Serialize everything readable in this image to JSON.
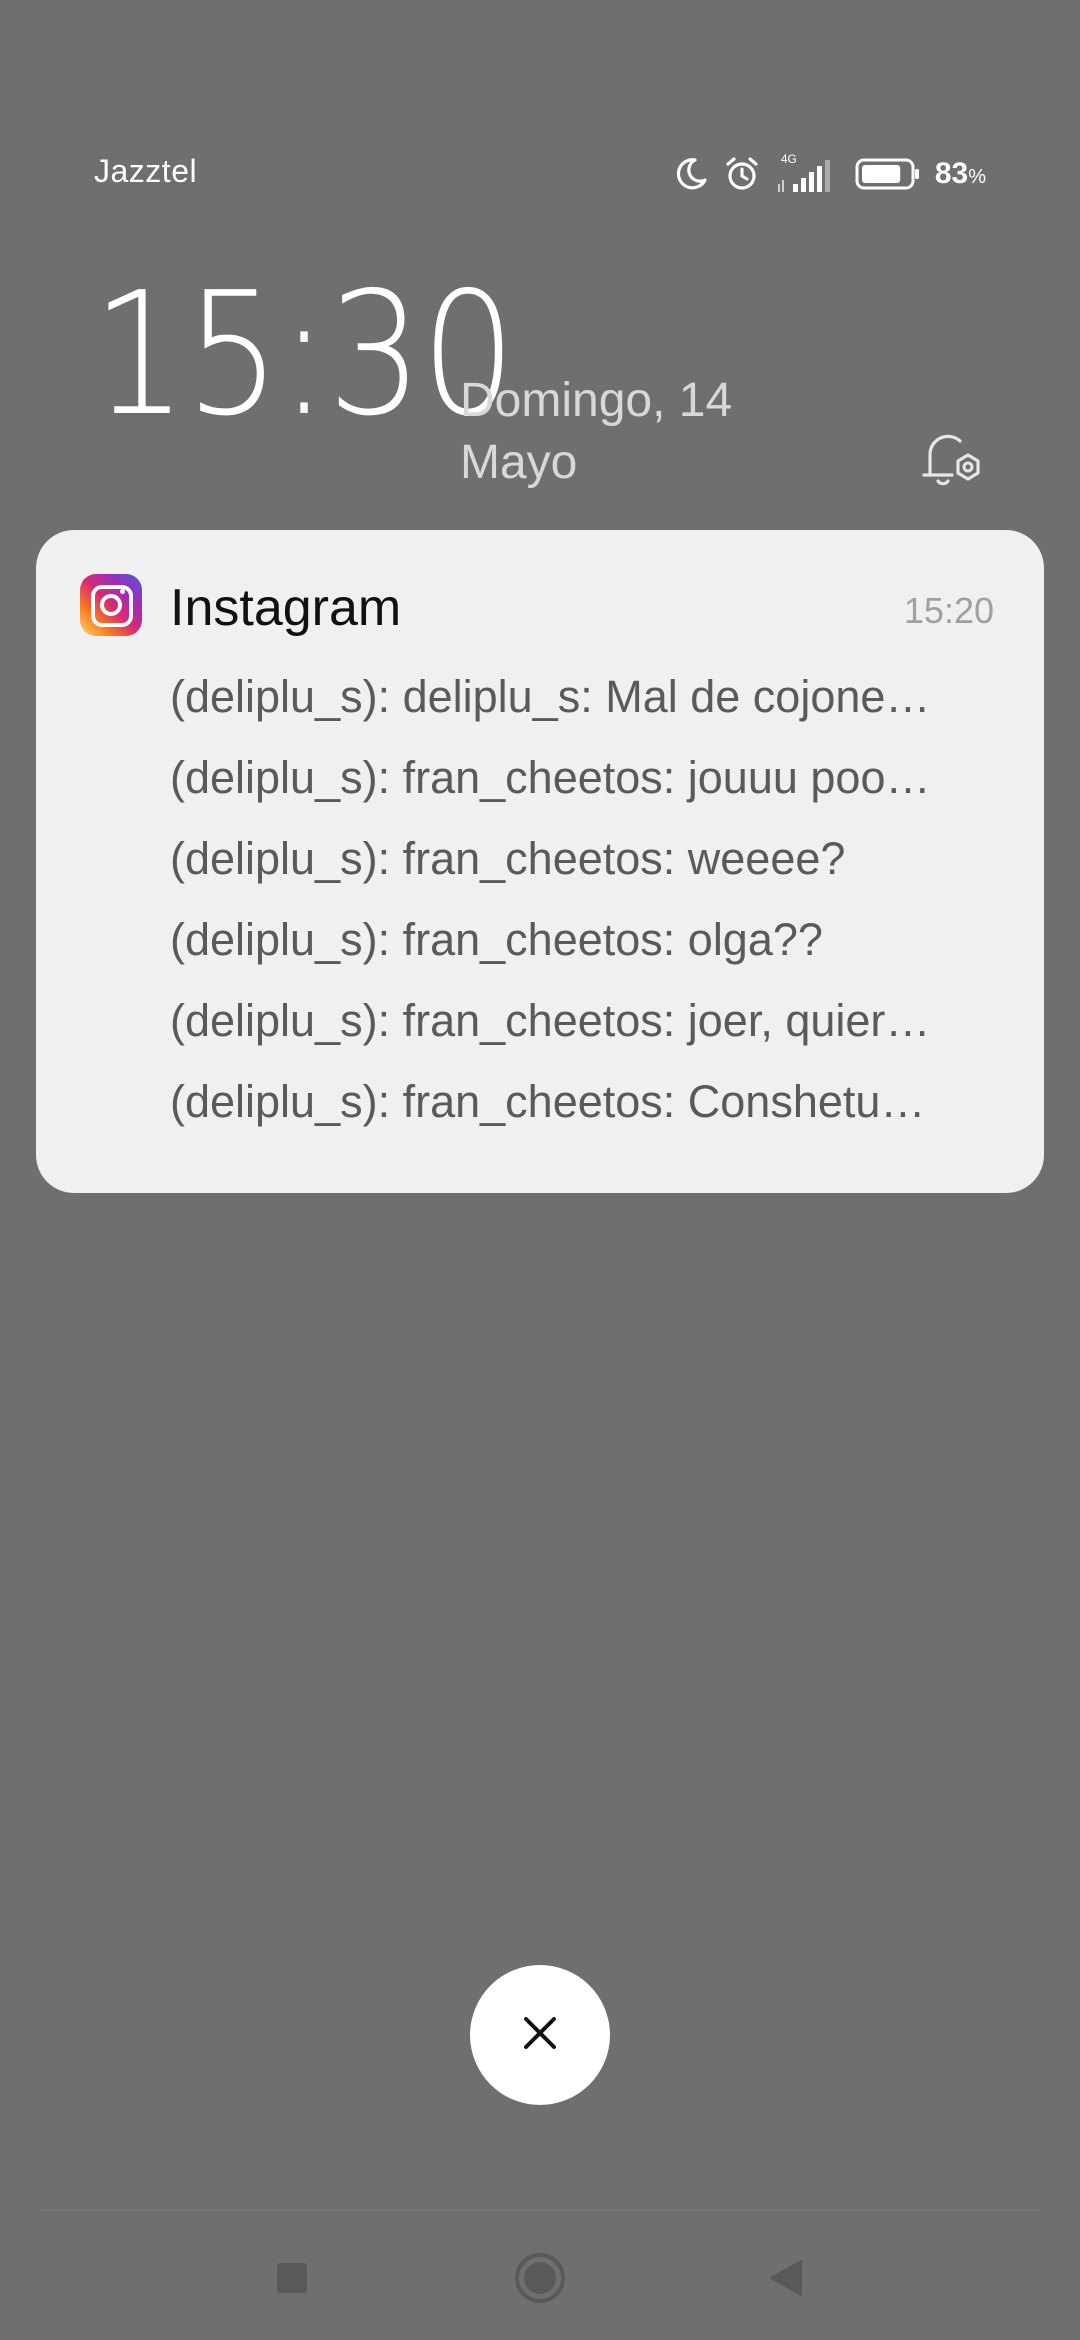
{
  "status_bar": {
    "carrier": "Jazztel",
    "network_label": "4G",
    "battery_percent": "83",
    "battery_percent_sign": "%",
    "battery_level": 0.83
  },
  "lockscreen": {
    "time": "15:30",
    "date_line1": "Domingo, 14",
    "date_line2": "Mayo"
  },
  "notification": {
    "app_name": "Instagram",
    "time": "15:20",
    "messages": [
      "(deliplu_s): deliplu_s: Mal de cojone…",
      "(deliplu_s): fran_cheetos: jouuu poo…",
      "(deliplu_s): fran_cheetos: weeee?",
      "(deliplu_s): fran_cheetos: olga??",
      "(deliplu_s): fran_cheetos: joer, quier…",
      "(deliplu_s): fran_cheetos: Conshetu…"
    ]
  },
  "icons": {
    "moon": "do-not-disturb-moon-icon",
    "alarm": "alarm-clock-icon",
    "signal": "cell-signal-icon",
    "battery": "battery-icon",
    "notification_settings": "bell-settings-icon",
    "dismiss": "close-icon",
    "nav_recent": "square-icon",
    "nav_home": "circle-icon",
    "nav_back": "triangle-back-icon"
  },
  "colors": {
    "background": "#6f6f6f",
    "card": "#f0f0f0",
    "text_primary": "#ffffff",
    "message_text": "#5a5a5a"
  }
}
